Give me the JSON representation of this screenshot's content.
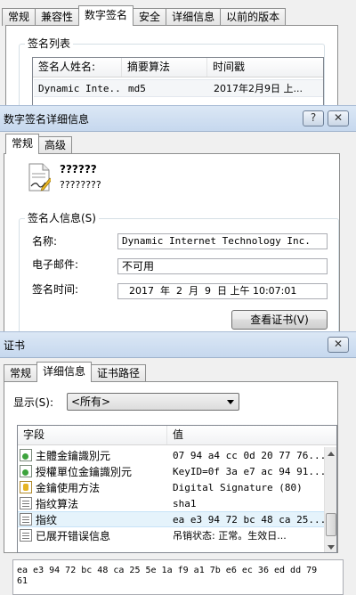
{
  "window1": {
    "tabs": [
      "常规",
      "兼容性",
      "数字签名",
      "安全",
      "详细信息",
      "以前的版本"
    ],
    "active_tab_index": 2,
    "group_title": "签名列表",
    "columns": [
      "签名人姓名:",
      "摘要算法",
      "时间戳"
    ],
    "rows": [
      {
        "name": "Dynamic Inte...",
        "algorithm": "md5",
        "timestamp": "2017年2月9日 上..."
      }
    ]
  },
  "window2": {
    "title": "数字签名详细信息",
    "help_label": "?",
    "close_label": "✕",
    "tabs": [
      "常规",
      "高级"
    ],
    "active_tab_index": 0,
    "info_title": "??????",
    "info_subtitle": "????????",
    "group_title": "签名人信息(S)",
    "name_label": "名称:",
    "name_value": "Dynamic Internet Technology Inc.",
    "email_label": "电子邮件:",
    "email_value": "不可用",
    "time_label": "签名时间:",
    "time_value": "2017  年  2  月  9  日 上午 10:07:01",
    "view_cert_label": "查看证书(V)"
  },
  "window3": {
    "title": "证书",
    "close_label": "✕",
    "tabs": [
      "常规",
      "详细信息",
      "证书路径"
    ],
    "active_tab_index": 1,
    "show_label": "显示(S):",
    "show_value": "<所有>",
    "columns": [
      "字段",
      "值"
    ],
    "fields": [
      {
        "icon": "certificate-icon",
        "name": "主體金鑰識別元",
        "value": "07 94 a4 cc 0d 20 77 76..."
      },
      {
        "icon": "certificate-icon",
        "name": "授權單位金鑰識別元",
        "value": "KeyID=0f 3a e7 ac 94 91..."
      },
      {
        "icon": "key-icon",
        "name": "金鑰使用方法",
        "value": "Digital Signature (80)"
      },
      {
        "icon": "document-icon",
        "name": "指纹算法",
        "value": "sha1"
      },
      {
        "icon": "document-icon",
        "name": "指纹",
        "value": "ea e3 94 72 bc 48 ca 25..."
      },
      {
        "icon": "document-icon",
        "name": "已展开错误信息",
        "value": "吊销状态: 正常。生效日..."
      }
    ],
    "selected_field_index": 4,
    "detail_text_line1": "ea e3 94 72 bc 48 ca 25 5e 1a f9 a1 7b e6 ec 36 ed dd 79",
    "detail_text_line2": "61"
  },
  "colors": {
    "titlebar": "#c6d8ee",
    "selection": "#e5f3fb",
    "window_bg": "#f0f0f0"
  }
}
